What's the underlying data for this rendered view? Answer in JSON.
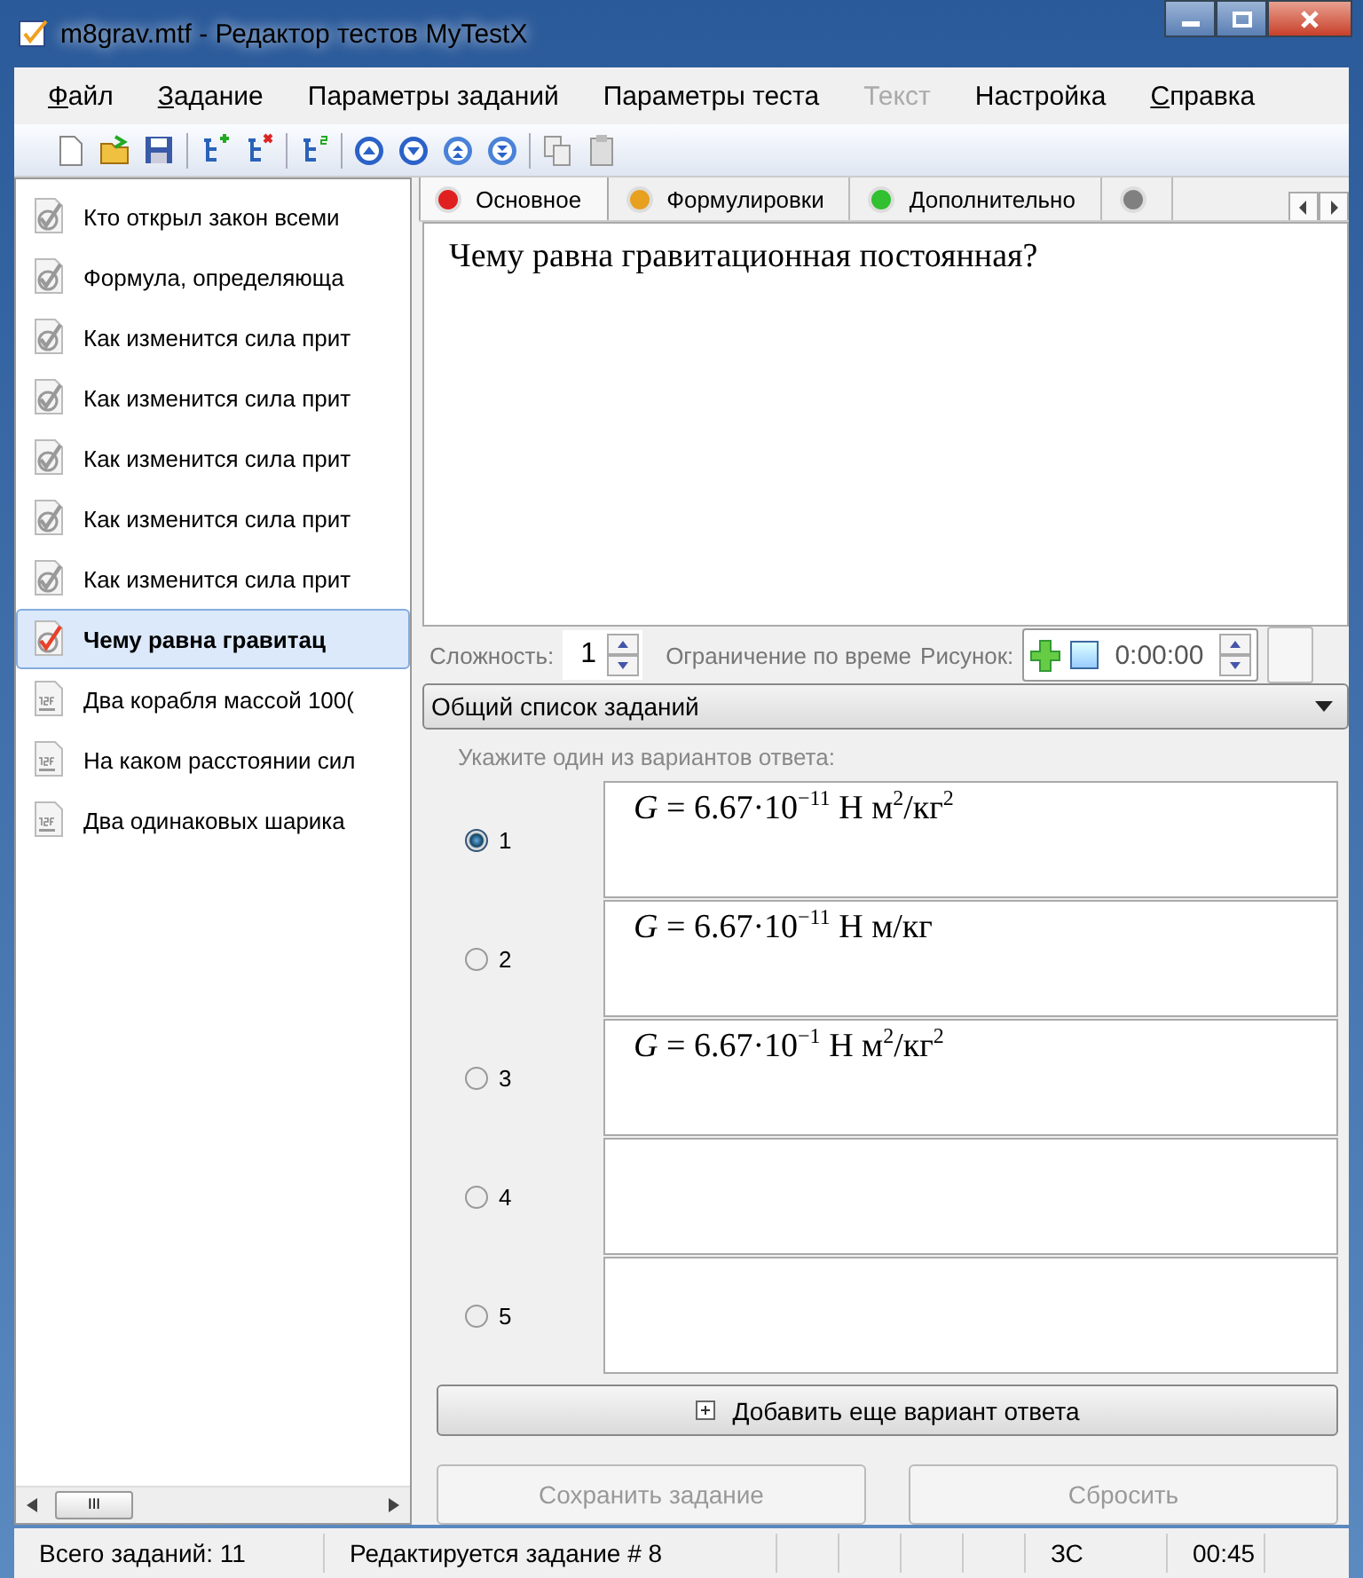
{
  "window": {
    "title": "m8grav.mtf - Редактор тестов MyTestX"
  },
  "menu": [
    {
      "label": "Файл",
      "mnemonic_first": true,
      "disabled": false
    },
    {
      "label": "Задание",
      "mnemonic_first": true,
      "disabled": false
    },
    {
      "label": "Параметры заданий",
      "mnemonic_first": false,
      "disabled": false
    },
    {
      "label": "Параметры теста",
      "mnemonic_first": false,
      "disabled": false
    },
    {
      "label": "Текст",
      "mnemonic_first": false,
      "disabled": true
    },
    {
      "label": "Настройка",
      "mnemonic_first": false,
      "disabled": false
    },
    {
      "label": "Справка",
      "mnemonic_first": true,
      "disabled": false
    }
  ],
  "tasks": [
    {
      "label": "Кто открыл закон всеми",
      "kind": "choice",
      "selected": false
    },
    {
      "label": "Формула, определяюща",
      "kind": "choice",
      "selected": false
    },
    {
      "label": "Как изменится сила прит",
      "kind": "choice",
      "selected": false
    },
    {
      "label": "Как изменится сила прит",
      "kind": "choice",
      "selected": false
    },
    {
      "label": "Как изменится сила прит",
      "kind": "choice",
      "selected": false
    },
    {
      "label": "Как изменится сила прит",
      "kind": "choice",
      "selected": false
    },
    {
      "label": "Как изменится сила прит",
      "kind": "choice",
      "selected": false
    },
    {
      "label": "Чему равна гравитац",
      "kind": "choice",
      "selected": true
    },
    {
      "label": "Два корабля массой 100(",
      "kind": "numeric",
      "selected": false
    },
    {
      "label": "На каком расстоянии сил",
      "kind": "numeric",
      "selected": false
    },
    {
      "label": "Два одинаковых шарика",
      "kind": "numeric",
      "selected": false
    }
  ],
  "tabs": [
    {
      "label": "Основное",
      "color": "#e02020",
      "selected": true
    },
    {
      "label": "Формулировки",
      "color": "#e8a020",
      "selected": false
    },
    {
      "label": "Дополнительно",
      "color": "#30c030",
      "selected": false
    },
    {
      "color": "#808080",
      "selected": false
    }
  ],
  "question": "Чему равна гравитационная постоянная?",
  "difficulty": {
    "label": "Сложность:",
    "value": "1"
  },
  "time_limit": {
    "label": "Ограничение по време",
    "value": "0:00:00",
    "checked": false
  },
  "picture_label": "Рисунок:",
  "task_list": {
    "value": "Общий список заданий"
  },
  "answers_hint": "Укажите один из вариантов ответа:",
  "answers": [
    {
      "number": "1",
      "text": "*G* = 6.67·10$^{−11}$ Н м$^{2}$/кг$^{2}$",
      "selected": true
    },
    {
      "number": "2",
      "text": "*G* = 6.67·10$^{−11}$ Н м/кг",
      "selected": false
    },
    {
      "number": "3",
      "text": "*G* = 6.67·10$^{−1}$ Н м$^{2}$/кг$^{2}$",
      "selected": false
    },
    {
      "number": "4",
      "selected": false
    },
    {
      "number": "5",
      "selected": false
    }
  ],
  "add_button": "Добавить еще вариант ответа",
  "save_button": {
    "label": "Сохранить задание",
    "disabled": true
  },
  "reset_button": {
    "label": "Сбросить",
    "disabled": true
  },
  "scroll_label": "III",
  "status_bar": {
    "total": "Всего заданий: 11",
    "editing": "Редактируется задание # 8",
    "mode": "ЗС",
    "time": "00:45"
  }
}
